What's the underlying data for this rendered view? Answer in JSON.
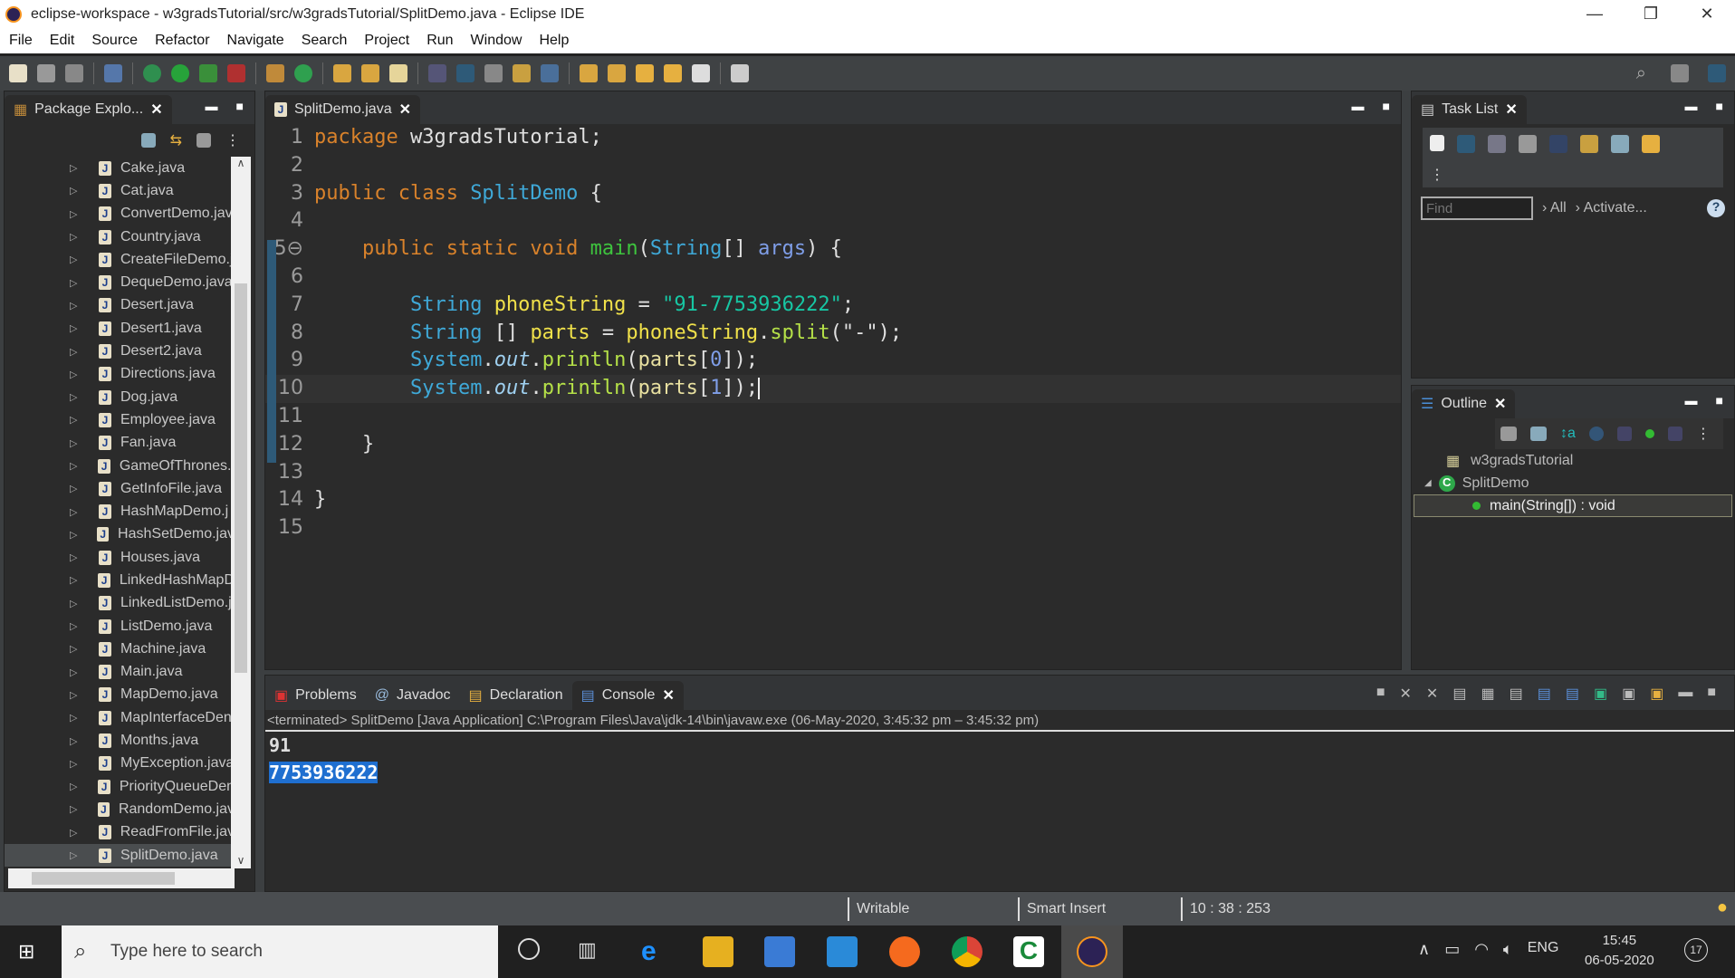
{
  "window": {
    "title": "eclipse-workspace - w3gradsTutorial/src/w3gradsTutorial/SplitDemo.java - Eclipse IDE",
    "minimize": "—",
    "restore": "❐",
    "close": "✕"
  },
  "menu": [
    "File",
    "Edit",
    "Source",
    "Refactor",
    "Navigate",
    "Search",
    "Project",
    "Run",
    "Window",
    "Help"
  ],
  "package_explorer": {
    "tab": "Package Explo...",
    "selected": "SplitDemo.java",
    "items": [
      "Cake.java",
      "Cat.java",
      "ConvertDemo.jav",
      "Country.java",
      "CreateFileDemo.j",
      "DequeDemo.java",
      "Desert.java",
      "Desert1.java",
      "Desert2.java",
      "Directions.java",
      "Dog.java",
      "Employee.java",
      "Fan.java",
      "GameOfThrones.j",
      "GetInfoFile.java",
      "HashMapDemo.j",
      "HashSetDemo.jav",
      "Houses.java",
      "LinkedHashMapD",
      "LinkedListDemo.j",
      "ListDemo.java",
      "Machine.java",
      "Main.java",
      "MapDemo.java",
      "MapInterfaceDen",
      "Months.java",
      "MyException.java",
      "PriorityQueueDen",
      "RandomDemo.jav",
      "ReadFromFile.jav",
      "SplitDemo.java"
    ]
  },
  "editor": {
    "tab": "SplitDemo.java",
    "lines": [
      [
        [
          "kw",
          "package "
        ],
        [
          "pl",
          "w3gradsTutorial;"
        ]
      ],
      [],
      [
        [
          "kw",
          "public class "
        ],
        [
          "cls",
          "SplitDemo"
        ],
        [
          "pl",
          " {"
        ]
      ],
      [],
      [
        [
          "pl",
          "    "
        ],
        [
          "kw",
          "public static void "
        ],
        [
          "mth",
          "main"
        ],
        [
          "pl",
          "("
        ],
        [
          "cls",
          "String"
        ],
        [
          "pl",
          "[] "
        ],
        [
          "arg",
          "args"
        ],
        [
          "pl",
          ") {"
        ]
      ],
      [],
      [
        [
          "pl",
          "        "
        ],
        [
          "cls",
          "String "
        ],
        [
          "var",
          "phoneString"
        ],
        [
          "pl",
          " = "
        ],
        [
          "str",
          "\"91-7753936222\""
        ],
        [
          "pl",
          ";"
        ]
      ],
      [
        [
          "pl",
          "        "
        ],
        [
          "cls",
          "String "
        ],
        [
          "pl",
          "[] "
        ],
        [
          "var",
          "parts"
        ],
        [
          "pl",
          " = "
        ],
        [
          "var",
          "phoneString"
        ],
        [
          "pl",
          "."
        ],
        [
          "call",
          "split"
        ],
        [
          "pl",
          "(\"-\");"
        ]
      ],
      [
        [
          "pl",
          "        "
        ],
        [
          "cls",
          "System"
        ],
        [
          "pl",
          "."
        ],
        [
          "fld",
          "out"
        ],
        [
          "pl",
          "."
        ],
        [
          "call",
          "println"
        ],
        [
          "pl",
          "("
        ],
        [
          "loc",
          "parts"
        ],
        [
          "pl",
          "["
        ],
        [
          "num",
          "0"
        ],
        [
          "pl",
          "]);"
        ]
      ],
      [
        [
          "pl",
          "        "
        ],
        [
          "cls",
          "System"
        ],
        [
          "pl",
          "."
        ],
        [
          "fld",
          "out"
        ],
        [
          "pl",
          "."
        ],
        [
          "call",
          "println"
        ],
        [
          "pl",
          "("
        ],
        [
          "loc",
          "parts"
        ],
        [
          "pl",
          "["
        ],
        [
          "num",
          "1"
        ],
        [
          "pl",
          "]);"
        ]
      ],
      [],
      [
        [
          "pl",
          "    }"
        ]
      ],
      [],
      [
        [
          "pl",
          "}"
        ]
      ],
      []
    ]
  },
  "task_list": {
    "tab": "Task List",
    "find_placeholder": "Find",
    "all": "All",
    "activate": "Activate..."
  },
  "outline": {
    "tab": "Outline",
    "package": "w3gradsTutorial",
    "class": "SplitDemo",
    "method": "main(String[]) : void"
  },
  "console": {
    "tabs": [
      "Problems",
      "Javadoc",
      "Declaration",
      "Console"
    ],
    "header": "<terminated> SplitDemo [Java Application] C:\\Program Files\\Java\\jdk-14\\bin\\javaw.exe  (06-May-2020, 3:45:32 pm – 3:45:32 pm)",
    "output": [
      "91",
      "7753936222"
    ]
  },
  "status": {
    "writable": "Writable",
    "insert": "Smart Insert",
    "position": "10 : 38 : 253"
  },
  "taskbar": {
    "search_placeholder": "Type here to search",
    "lang": "ENG",
    "time": "15:45",
    "date": "06-05-2020",
    "notifications": "17"
  }
}
